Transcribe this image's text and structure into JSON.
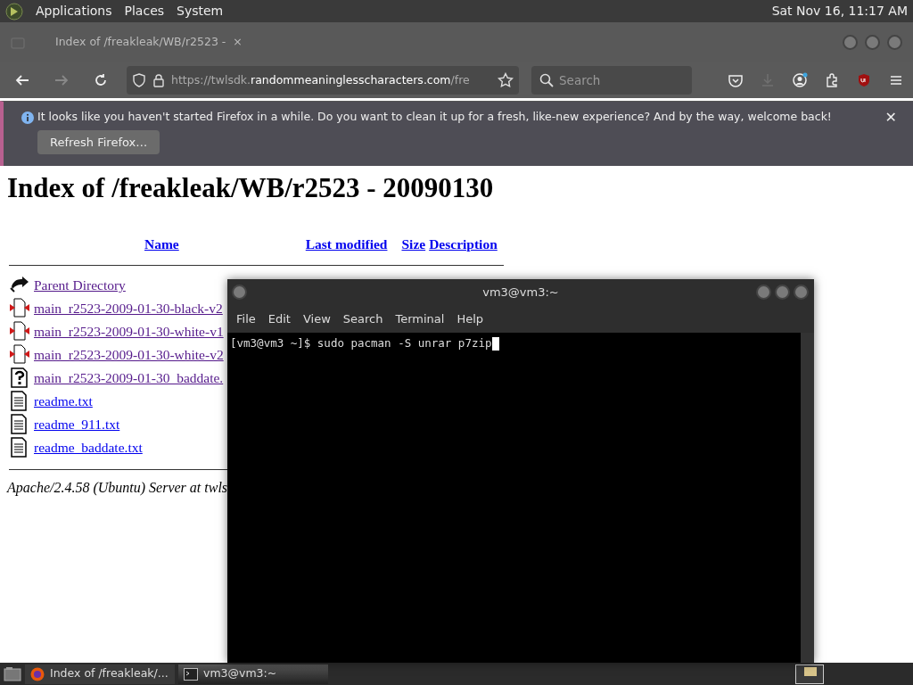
{
  "top_panel": {
    "menus": [
      "Applications",
      "Places",
      "System"
    ],
    "clock": "Sat Nov 16, 11:17 AM"
  },
  "browser": {
    "tab": {
      "title": "Index of /freakleak/WB/r2523 -",
      "close": "×"
    },
    "nav_buttons": [
      {
        "kind": "back",
        "disabled": false
      },
      {
        "kind": "forward",
        "disabled": true
      },
      {
        "kind": "reload",
        "disabled": false
      }
    ],
    "url": {
      "prefix": "https://twlsdk.",
      "domain": "randommeaninglesscharacters.com",
      "suffix": "/fre"
    },
    "search": {
      "placeholder": "Search"
    },
    "notification": {
      "message": "It looks like you haven't started Firefox in a while. Do you want to clean it up for a fresh, like-new experience? And by the way, welcome back!",
      "button": "Refresh Firefox…",
      "close": "✕"
    }
  },
  "page": {
    "title": "Index of /freakleak/WB/r2523 - 20090130",
    "columns": [
      "Name",
      "Last modified",
      "Size",
      "Description"
    ],
    "rows": [
      {
        "kind": "parent",
        "name": "Parent Directory"
      },
      {
        "kind": "binary",
        "name": "main_r2523-2009-01-30-black-v2"
      },
      {
        "kind": "binary",
        "name": "main_r2523-2009-01-30-white-v1"
      },
      {
        "kind": "binary",
        "name": "main_r2523-2009-01-30-white-v2"
      },
      {
        "kind": "unknown",
        "name": "main_r2523-2009-01-30_baddate."
      },
      {
        "kind": "text",
        "name": "readme.txt"
      },
      {
        "kind": "text",
        "name": "readme_911.txt"
      },
      {
        "kind": "text",
        "name": "readme_baddate.txt"
      }
    ],
    "footer": "Apache/2.4.58 (Ubuntu) Server at twls"
  },
  "terminal": {
    "title": "vm3@vm3:~",
    "menus": [
      "File",
      "Edit",
      "View",
      "Search",
      "Terminal",
      "Help"
    ],
    "prompt": "[vm3@vm3 ~]$ sudo pacman -S unrar p7zip"
  },
  "taskbar": {
    "items": [
      {
        "kind": "firefox",
        "label": "Index of /freakleak/...",
        "selected": false
      },
      {
        "kind": "terminal",
        "label": "vm3@vm3:~",
        "selected": true
      }
    ]
  }
}
